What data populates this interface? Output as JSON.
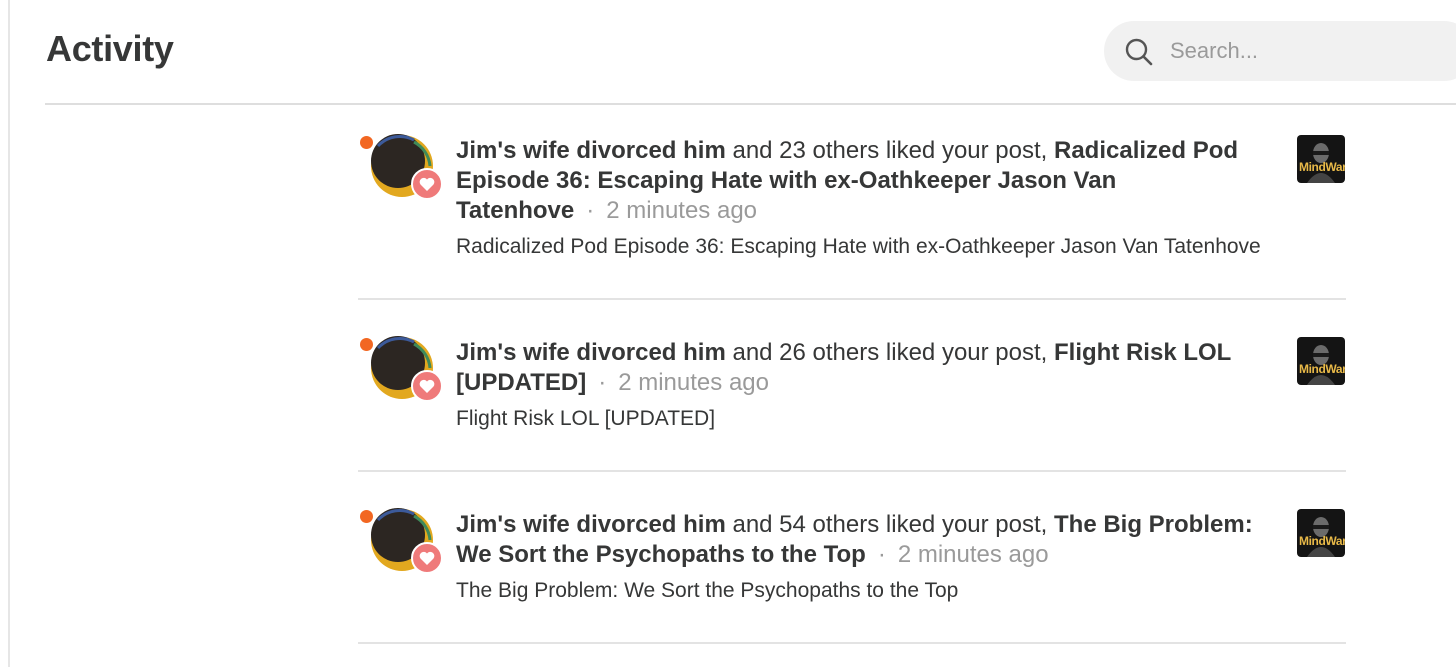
{
  "header": {
    "title": "Activity",
    "search": {
      "placeholder": "Search..."
    }
  },
  "notifications": [
    {
      "actor": "Jim's wife divorced him",
      "action": "and 23 others liked your post,",
      "post_title": "Radicalized Pod Episode 36: Escaping Hate with ex-Oathkeeper Jason Van Tatenhove",
      "separator": "·",
      "time": "2 minutes ago",
      "subtitle": "Radicalized Pod Episode 36: Escaping Hate with ex-Oathkeeper Jason Van Tatenhove",
      "thumbnail_text": "MindWar",
      "unread": true
    },
    {
      "actor": "Jim's wife divorced him",
      "action": "and 26 others liked your post,",
      "post_title": "Flight Risk LOL [UPDATED]",
      "separator": "·",
      "time": "2 minutes ago",
      "subtitle": "Flight Risk LOL [UPDATED]",
      "thumbnail_text": "MindWar",
      "unread": true
    },
    {
      "actor": "Jim's wife divorced him",
      "action": "and 54 others liked your post,",
      "post_title": "The Big Problem: We Sort the Psychopaths to the Top",
      "separator": "·",
      "time": "2 minutes ago",
      "subtitle": "The Big Problem: We Sort the Psychopaths to the Top",
      "thumbnail_text": "MindWar",
      "unread": true
    }
  ],
  "icons": {
    "search": "search-icon",
    "unread": "unread-dot-icon",
    "like": "heart-icon",
    "avatar": "user-avatar",
    "thumbnail": "post-thumbnail"
  },
  "colors": {
    "unread_dot": "#f26722",
    "heart_badge": "#ef7a7a",
    "text": "#363737",
    "muted": "#9a9a9a"
  }
}
